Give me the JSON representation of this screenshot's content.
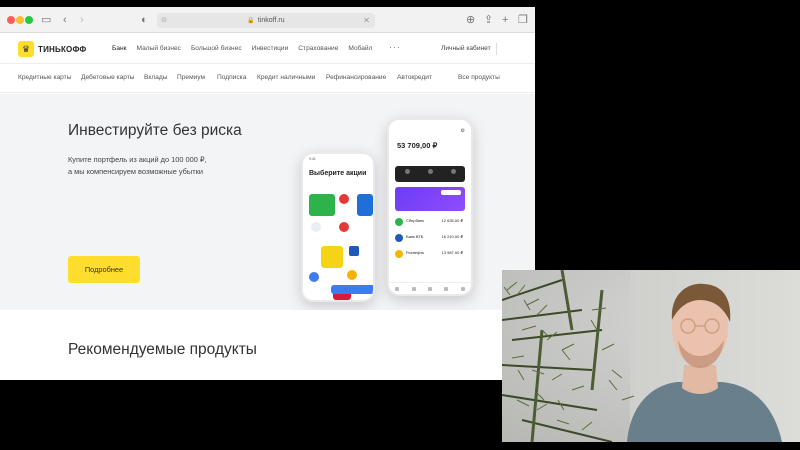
{
  "browser": {
    "url": "tinkoff.ru"
  },
  "site": {
    "logo_text": "ТИНЬКОФФ",
    "main_nav": [
      "Банк",
      "Малый бизнес",
      "Большой бизнес",
      "Инвестиции",
      "Страхование",
      "Мобайл"
    ],
    "active_nav": "Банк",
    "more": "···",
    "cabinet": "Личный кабинет",
    "sub_nav": [
      "Кредитные карты",
      "Дебетовые карты",
      "Вклады",
      "Премиум",
      "Подписка",
      "Кредит наличными",
      "Рефинансирование",
      "Автокредит",
      "Все продукты"
    ]
  },
  "hero": {
    "title": "Инвестируйте без риска",
    "desc_line1": "Купите портфель из акций до 100 000 ₽,",
    "desc_line2": "а мы компенсируем возможные убытки",
    "cta": "Подробнее"
  },
  "phone_back": {
    "title": "Выберите акции"
  },
  "phone_front": {
    "amount": "53 709,00 ₽",
    "stocks": [
      {
        "name": "Сбербанк",
        "value": "12 635,00 ₽"
      },
      {
        "name": "Банк ВТБ",
        "value": "16 210,00 ₽"
      },
      {
        "name": "Роснефть",
        "value": "13 987,00 ₽"
      }
    ]
  },
  "recommend": {
    "title": "Рекомендуемые продукты"
  },
  "colors": {
    "accent": "#ffdd2d",
    "promo": "#6c3cf5"
  }
}
